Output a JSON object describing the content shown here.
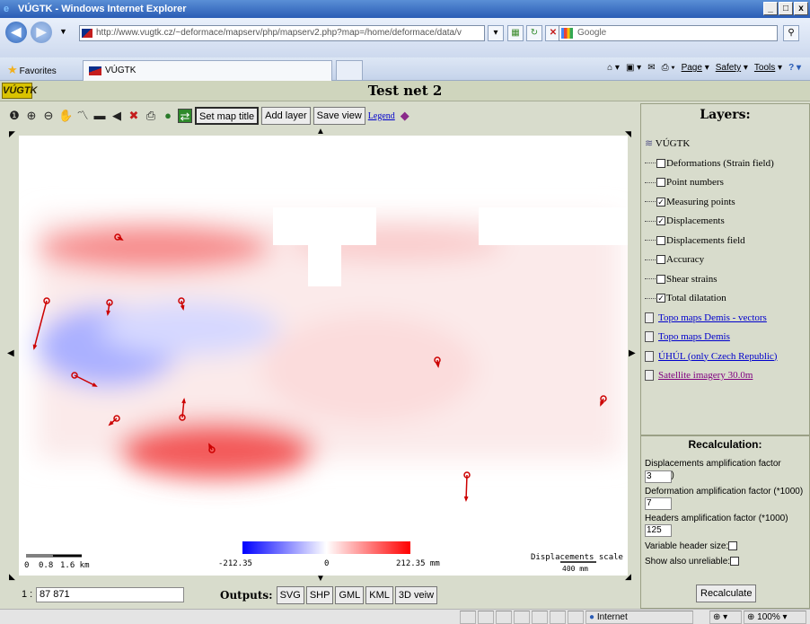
{
  "window": {
    "title": "VÚGTK - Windows Internet Explorer",
    "buttons": [
      "_",
      "□",
      "x"
    ]
  },
  "browser": {
    "url": "http://www.vugtk.cz/~deformace/mapserv/php/mapserv2.php?map=/home/deformace/data/v",
    "url_host": "vugtk.cz",
    "search_placeholder": "Google",
    "favorites_label": "Favorites",
    "tab_title": "VÚGTK",
    "commands": {
      "page": "Page",
      "safety": "Safety",
      "tools": "Tools"
    }
  },
  "app": {
    "logo_text": "VÚGTK",
    "title": "Test net 2",
    "toolbar_buttons": {
      "set_map_title": "Set map title",
      "add_layer": "Add layer",
      "save_view": "Save view",
      "legend": "Legend"
    }
  },
  "map": {
    "color_scale": {
      "min_label": "-212.35",
      "mid_label": "0",
      "max_label": "212.35 mm",
      "min_color": "#0000ff",
      "max_color": "#ff0000"
    },
    "distance_scale": {
      "labels": [
        "0",
        "0.8",
        "1.6 km"
      ]
    },
    "displacement_scale": {
      "label": "Displacements scale",
      "value": "400 mm"
    }
  },
  "bottom": {
    "scale_prefix": "1 :",
    "scale_value": "87 871",
    "outputs_label": "Outputs:",
    "outputs": [
      "SVG",
      "SHP",
      "GML",
      "KML",
      "3D veiw"
    ]
  },
  "layers": {
    "heading": "Layers:",
    "root": "VÚGTK",
    "items": [
      {
        "label": "Deformations (Strain field)",
        "checked": false
      },
      {
        "label": "Point numbers",
        "checked": false
      },
      {
        "label": "Measuring points",
        "checked": true
      },
      {
        "label": "Displacements",
        "checked": true
      },
      {
        "label": "Displacements field",
        "checked": false
      },
      {
        "label": "Accuracy",
        "checked": false
      },
      {
        "label": "Shear strains",
        "checked": false
      },
      {
        "label": "Total dilatation",
        "checked": true
      }
    ],
    "external": [
      "Topo maps Demis - vectors",
      "Topo maps Demis",
      "ÚHÚL (only Czech Republic)",
      "Satellite imagery 30.0m"
    ]
  },
  "recalculation": {
    "heading": "Recalculation:",
    "displacement_factor_label": "Displacements amplification factor (*1000)",
    "displacement_factor": "3",
    "deformation_factor_label": "Deformation amplification factor (*1000)",
    "deformation_factor": "7",
    "headers_factor_label": "Headers amplification factor (*1000)",
    "headers_factor": "125",
    "variable_header_label": "Variable header size:",
    "show_unreliable_label": "Show also unreliable:",
    "button": "Recalculate"
  },
  "status": {
    "zone": "Internet",
    "zoom": "100%"
  }
}
